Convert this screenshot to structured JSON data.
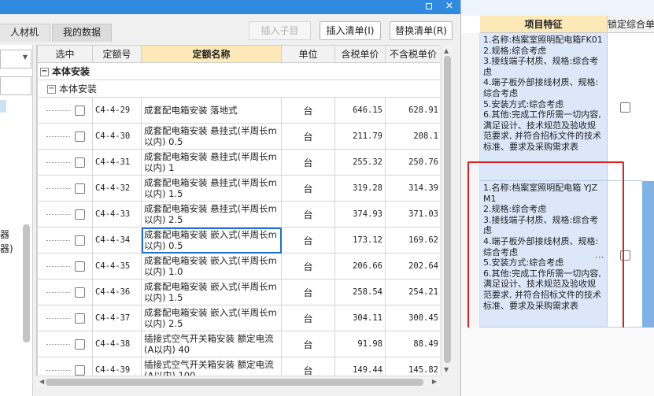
{
  "titlebar": {
    "maximize_icon": "maximize-icon",
    "close_glyph": "×"
  },
  "tabs": [
    {
      "label": "人材机"
    },
    {
      "label": "我的数据"
    }
  ],
  "toolbar": {
    "insert_child": "插入子目",
    "insert_list": "插入清单(I)",
    "replace_list": "替换清单(R)"
  },
  "sidebar": {
    "line1": "器",
    "line2": "器)"
  },
  "grid": {
    "columns": [
      "选中",
      "定额号",
      "定额名称",
      "单位",
      "含税单价",
      "不含税单价"
    ],
    "group1": "本体安装",
    "group2": "本体安装",
    "rows": [
      {
        "code": "C4-4-29",
        "name": "成套配电箱安装 落地式",
        "unit": "台",
        "price_tax": "646.15",
        "price_notax": "628.91"
      },
      {
        "code": "C4-4-30",
        "name": "成套配电箱安装 悬挂式(半周长m以内) 0.5",
        "unit": "台",
        "price_tax": "211.79",
        "price_notax": "208.1"
      },
      {
        "code": "C4-4-31",
        "name": "成套配电箱安装 悬挂式(半周长m以内) 1",
        "unit": "台",
        "price_tax": "255.32",
        "price_notax": "250.76"
      },
      {
        "code": "C4-4-32",
        "name": "成套配电箱安装 悬挂式(半周长m以内) 1.5",
        "unit": "台",
        "price_tax": "319.28",
        "price_notax": "314.39"
      },
      {
        "code": "C4-4-33",
        "name": "成套配电箱安装 悬挂式(半周长m以内) 2.5",
        "unit": "台",
        "price_tax": "374.93",
        "price_notax": "371.03"
      },
      {
        "code": "C4-4-34",
        "name": "成套配电箱安装 嵌入式(半周长m以内) 0.5",
        "unit": "台",
        "price_tax": "173.12",
        "price_notax": "169.62"
      },
      {
        "code": "C4-4-35",
        "name": "成套配电箱安装 嵌入式(半周长m以内) 1.0",
        "unit": "台",
        "price_tax": "206.66",
        "price_notax": "202.64"
      },
      {
        "code": "C4-4-36",
        "name": "成套配电箱安装 嵌入式(半周长m以内) 1.5",
        "unit": "台",
        "price_tax": "258.54",
        "price_notax": "254.21"
      },
      {
        "code": "C4-4-37",
        "name": "成套配电箱安装 嵌入式(半周长m以内) 2.5",
        "unit": "台",
        "price_tax": "304.11",
        "price_notax": "300.45"
      },
      {
        "code": "C4-4-38",
        "name": "插接式空气开关箱安装 额定电流(A以内) 40",
        "unit": "台",
        "price_tax": "91.98",
        "price_notax": "88.49"
      },
      {
        "code": "C4-4-39",
        "name": "插接式空气开关箱安装 额定电流(A以内) 100",
        "unit": "台",
        "price_tax": "149.44",
        "price_notax": "145.82"
      }
    ]
  },
  "right_panel": {
    "header_feature": "项目特征",
    "header_lock": "锁定综合单",
    "items": [
      {
        "text": "1.名称:档案室照明配电箱FK01\n2.规格:综合考虑\n3.接线端子材质、规格:综合考虑\n4.端子板外部接线材质、规格:综合考虑\n5.安装方式:综合考虑\n6.其他:完成工作所需一切内容, 满足设计、技术规范及验收规范要求, 并符合招标文件的技术标准、要求及采购需求表"
      },
      {
        "text": "1.名称:档案室照明配电箱 YJZM1\n2.规格:综合考虑\n3.接线端子材质、规格:综合考虑\n4.端子板外部接线材质、规格:综合考虑\n5.安装方式:综合考虑\n6.其他:完成工作所需一切内容, 满足设计、技术规范及验收规范要求, 并符合招标文件的技术标准、要求及采购需求表"
      }
    ],
    "ellipsis": "···"
  },
  "colors": {
    "title_bar": "#2f8ae0",
    "header_active": "#fde9b7",
    "selection": "#dce8fa",
    "highlight_box": "#e02020"
  }
}
